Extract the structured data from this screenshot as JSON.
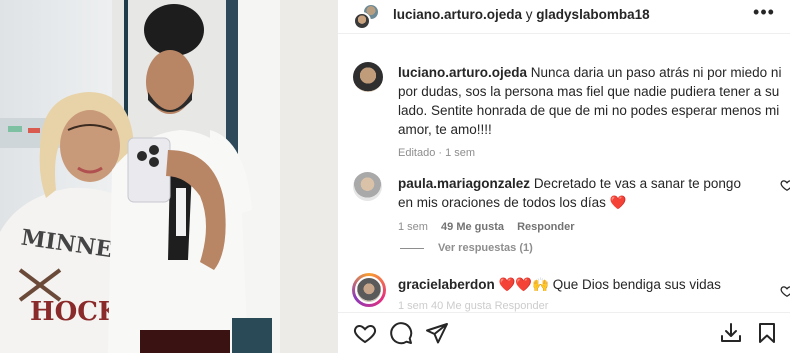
{
  "header": {
    "user1": "luciano.arturo.ojeda",
    "conjunction": " y ",
    "user2": "gladyslabomba18",
    "more_icon": "•••"
  },
  "caption": {
    "username": "luciano.arturo.ojeda",
    "text": "Nunca daria un paso atrás ni por miedo ni por dudas, sos la persona mas fiel que nadie pudiera tener a su lado. Sentite honrada de que de mi no podes esperar menos mi amor, te amo!!!!",
    "edited": "Editado",
    "sep": " · ",
    "time": "1 sem"
  },
  "comments": [
    {
      "username": "paula.mariagonzalez",
      "text": "Decretado te vas a sanar te pongo en mis oraciones de todos los días",
      "emoji": "❤️",
      "time": "1 sem",
      "likes": "49 Me gusta",
      "reply": "Responder"
    },
    {
      "username": "gracielaberdon",
      "text_emoji": "❤️❤️🙌",
      "text": "Que Dios bendiga sus vidas",
      "faded_meta": "1 sem   40 Me gusta   Responder"
    }
  ],
  "view_replies": "Ver respuestas (1)",
  "photo": {
    "shirt_text_top": "MINNESO",
    "shirt_text_bottom": "HOCK"
  },
  "icons": {
    "like": "heart-outline-icon",
    "comment": "comment-bubble-icon",
    "share": "paper-plane-icon",
    "download": "download-icon",
    "save": "bookmark-icon"
  },
  "colors": {
    "heart_red": "#ed4956",
    "text": "#262626",
    "muted": "#8e8e8e"
  }
}
